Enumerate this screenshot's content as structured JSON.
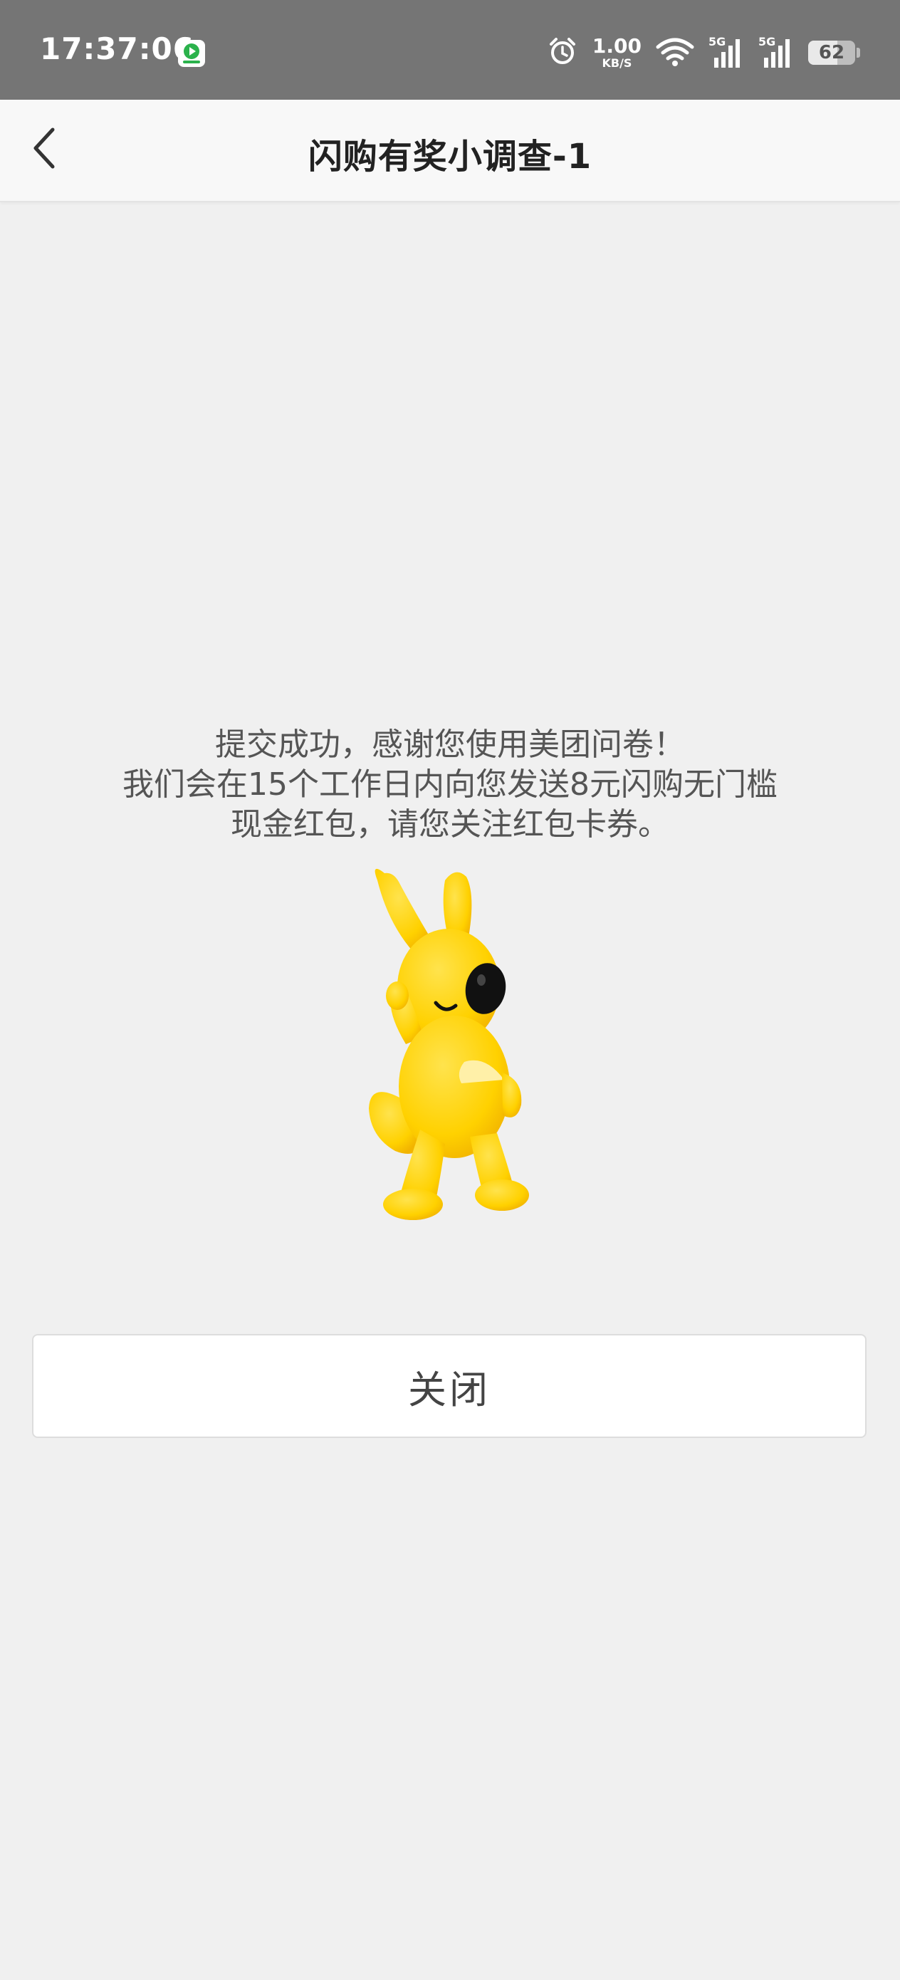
{
  "status_bar": {
    "time": "17:37:06",
    "net_speed_value": "1.00",
    "net_speed_unit": "KB/S",
    "signal_1_label": "5G",
    "signal_2_label": "5G",
    "battery_level": "62",
    "battery_fraction": 0.62,
    "icons": [
      "app-notification-icon",
      "alarm-icon",
      "wifi-icon",
      "signal-icon",
      "signal-icon",
      "battery-icon"
    ]
  },
  "nav": {
    "title": "闪购有奖小调查-1",
    "back_icon": "chevron-left-icon"
  },
  "message": {
    "line1": "提交成功，感谢您使用美团问卷！",
    "line2": "我们会在15个工作日内向您发送8元闪购无门槛",
    "line3": "现金红包，请您关注红包卡券。"
  },
  "mascot": {
    "icon": "kangaroo-mascot",
    "colors": {
      "body": "#ffd100",
      "shade": "#f3b600",
      "eye": "#111111",
      "patch": "#fff0a8"
    }
  },
  "actions": {
    "close_label": "关闭"
  },
  "colors": {
    "status_bar_bg": "#757575",
    "nav_bg": "#f8f8f8",
    "page_bg": "#f0f0f0",
    "text_primary": "#222222",
    "text_secondary": "#555555"
  }
}
